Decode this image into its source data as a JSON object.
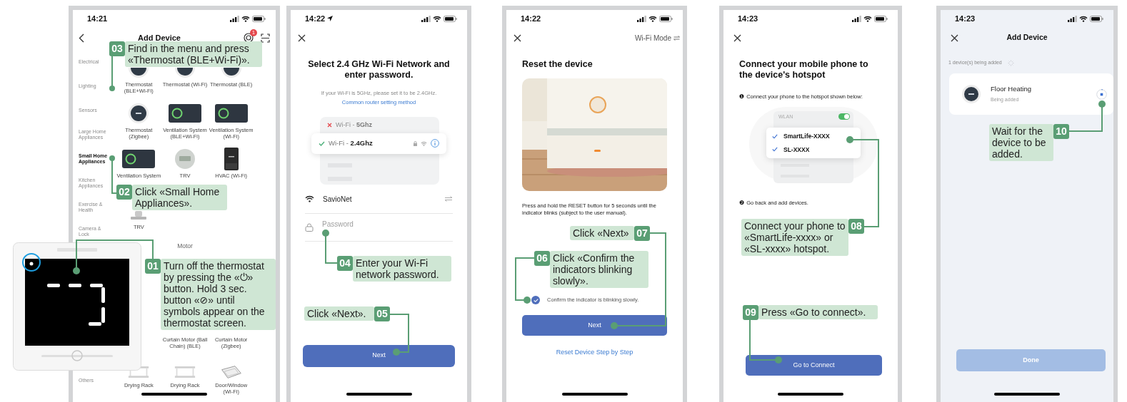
{
  "screens": [
    {
      "kind": "catalog",
      "time": "14:21",
      "title": "Add Device",
      "badge": "1",
      "categories": [
        {
          "label": "Electrical",
          "selected": false
        },
        {
          "label": "Lighting",
          "selected": false
        },
        {
          "label": "Sensors",
          "selected": false
        },
        {
          "label": "Large Home Appliances",
          "selected": false
        },
        {
          "label": "Small Home Appliances",
          "selected": true
        },
        {
          "label": "Kitchen Appliances",
          "selected": false
        },
        {
          "label": "Exercise & Health",
          "selected": false
        },
        {
          "label": "Camera & Lock",
          "selected": false
        },
        {
          "label": "Others",
          "selected": false
        }
      ],
      "sections": [
        {
          "devices": [
            {
              "kind": "thermostat",
              "label": "Thermostat (BLE+Wi-Fi)"
            },
            {
              "kind": "thermostat",
              "label": "Thermostat (Wi-Fi)"
            },
            {
              "kind": "thermostat",
              "label": "Thermostat (BLE)"
            },
            {
              "kind": "thermostat",
              "label": "Thermostat (Zigbee)"
            },
            {
              "kind": "ventilation",
              "label": "Ventilation System (BLE+Wi-Fi)"
            },
            {
              "kind": "ventilation",
              "label": "Ventilation System (Wi-Fi)"
            },
            {
              "kind": "ventilation",
              "label": "Ventilation System"
            },
            {
              "kind": "trv",
              "label": "TRV"
            },
            {
              "kind": "hvac",
              "label": "HVAC (Wi-Fi)"
            },
            {
              "kind": "valve",
              "label": "TRV"
            }
          ]
        },
        {
          "title": "Motor",
          "devices": [
            {
              "kind": "curtain",
              "label": "Curtain Motor (Ball Chain) (BLE)"
            },
            {
              "kind": "curtain",
              "label": "Curtain Motor (Zigbee)"
            }
          ]
        },
        {
          "devices": [
            {
              "kind": "rack",
              "label": "Drying Rack"
            },
            {
              "kind": "rack",
              "label": "Drying Rack"
            },
            {
              "kind": "door",
              "label": "Door/Window (Wi-Fi)"
            }
          ]
        }
      ]
    },
    {
      "kind": "wifi_setup",
      "time": "14:22",
      "title": "Select 2.4 GHz Wi-Fi Network and enter password.",
      "hint": "If your Wi-Fi is 5GHz, please set it to be 2.4GHz.",
      "link": "Common router setting method",
      "networks": [
        {
          "label": "Wi-Fi - **5Ghz**",
          "selected": false
        },
        {
          "label": "Wi-Fi - **2.4Ghz**",
          "selected": true
        }
      ],
      "ssid": "SavioNet",
      "password_placeholder": "Password",
      "button": "Next"
    },
    {
      "kind": "reset",
      "time": "14:22",
      "mode": "Wi-Fi Mode",
      "title": "Reset the device",
      "instruction": "Press and hold the RESET button for 5 seconds until the indicator blinks (subject to the user manual).",
      "confirm": {
        "label": "Confirm the indicator is blinking slowly.",
        "checked": true
      },
      "button": "Next",
      "link": "Reset Device Step by Step"
    },
    {
      "kind": "hotspot",
      "time": "14:23",
      "title": "Connect your mobile phone to the device's hotspot",
      "steps": [
        {
          "marker": "❶",
          "text": "Connect your phone to the hotspot shown below:"
        },
        {
          "marker": "❷",
          "text": "Go back and add devices."
        }
      ],
      "wlan": {
        "label": "WLAN",
        "on": true
      },
      "hotspots": [
        {
          "name": "SmartLife-XXXX",
          "checked": true
        },
        {
          "name": "SL-XXXX",
          "checked": true
        }
      ],
      "button": "Go to Connect"
    },
    {
      "kind": "adding",
      "time": "14:23",
      "title": "Add Device",
      "status": "1 device(s) being added",
      "device": {
        "name": "Floor Heating",
        "status": "Being added"
      },
      "button": {
        "label": "Done",
        "disabled": true
      }
    }
  ],
  "callouts": [
    {
      "number": "03",
      "text": "Find in the menu and press «Thermostat (BLE+Wi-Fi)»."
    },
    {
      "number": "02",
      "text": "Click «Small Home Appliances»."
    },
    {
      "number": "01",
      "text": "Turn off the thermostat by pressing the «⏻» button. Hold 3 sec. button «⊘» until symbols appear on the thermostat screen."
    },
    {
      "number": "04",
      "text": "Enter your Wi-Fi network password."
    },
    {
      "number": "05",
      "text": "Click «Next»."
    },
    {
      "number": "07",
      "text": "Click «Next»"
    },
    {
      "number": "06",
      "text": "Click «Confirm the indicators blinking slowly»."
    },
    {
      "number": "08",
      "text": "Connect your phone to «SmartLife-xxxx» or «SL-xxxx» hotspot."
    },
    {
      "number": "09",
      "text": "Press «Go to connect»."
    },
    {
      "number": "10",
      "text": "Wait for the device to be added."
    }
  ]
}
